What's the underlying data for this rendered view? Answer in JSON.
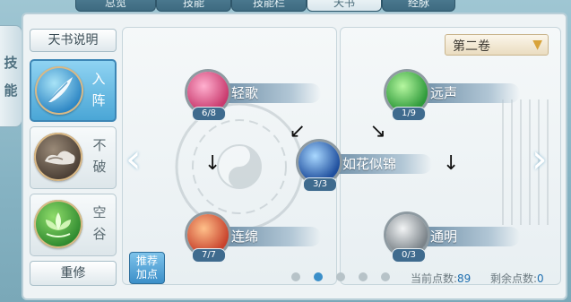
{
  "tabs": [
    "总览",
    "技能",
    "技能栏",
    "天书",
    "经脉"
  ],
  "active_tab": "天书",
  "side_tab_label": [
    "技",
    "能"
  ],
  "tianshu_desc_button": "天书说明",
  "volume_select": "第二卷",
  "skills": [
    {
      "label": "入阵",
      "active": true,
      "icon": "feather-icon"
    },
    {
      "label": "不破",
      "active": false,
      "icon": "cloud-icon"
    },
    {
      "label": "空谷",
      "active": false,
      "icon": "lotus-icon"
    }
  ],
  "reset_button": "重修",
  "recommend_button": [
    "推荐",
    "加点"
  ],
  "nodes": [
    {
      "name": "轻歌",
      "count": "6/8",
      "color": "#d94c7e"
    },
    {
      "name": "如花似锦",
      "count": "3/3",
      "color": "#2e6fb8"
    },
    {
      "name": "连绵",
      "count": "7/7",
      "color": "#d35a3a"
    },
    {
      "name": "远声",
      "count": "1/9",
      "color": "#3fae45"
    },
    {
      "name": "通明",
      "count": "0/3",
      "color": "#9aa3a8"
    }
  ],
  "footer": {
    "current_points_label": "当前点数:",
    "current_points": "89",
    "remaining_points_label": "剩余点数:",
    "remaining_points": "0"
  },
  "page_dots": {
    "total": 5,
    "active": 2
  },
  "colors": {
    "accent": "#3b8fc9",
    "active_skill": "#4aa6d6",
    "points": "#1e6fb0"
  }
}
